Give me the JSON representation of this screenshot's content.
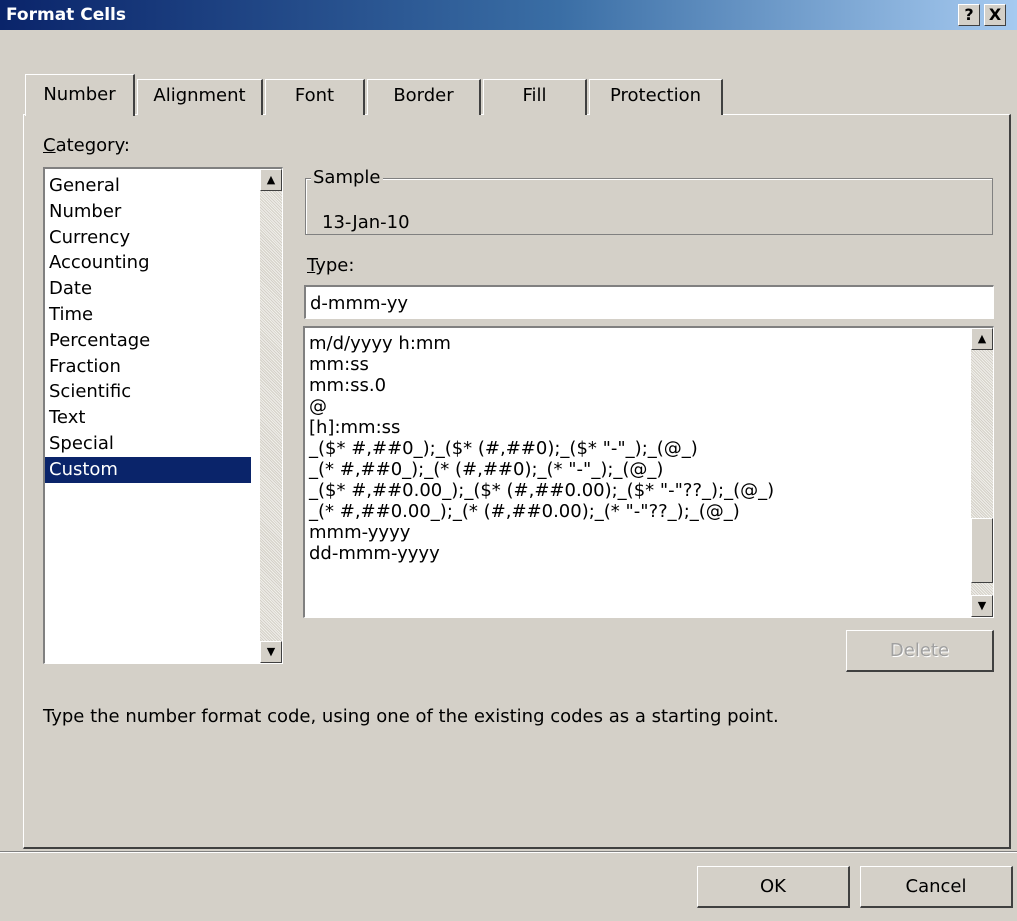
{
  "window": {
    "title": "Format Cells",
    "help_label": "?",
    "close_label": "X"
  },
  "tabs": [
    {
      "label": "Number",
      "active": true
    },
    {
      "label": "Alignment"
    },
    {
      "label": "Font"
    },
    {
      "label": "Border"
    },
    {
      "label": "Fill"
    },
    {
      "label": "Protection"
    }
  ],
  "category": {
    "label_prefix": "C",
    "label_rest": "ategory:",
    "items": [
      "General",
      "Number",
      "Currency",
      "Accounting",
      "Date",
      "Time",
      "Percentage",
      "Fraction",
      "Scientific",
      "Text",
      "Special",
      "Custom"
    ],
    "selected": "Custom"
  },
  "sample": {
    "legend": "Sample",
    "value": "13-Jan-10"
  },
  "type": {
    "label_prefix": "T",
    "label_rest": "ype:",
    "value": "d-mmm-yy",
    "formats": [
      "m/d/yyyy h:mm",
      "mm:ss",
      "mm:ss.0",
      "@",
      "[h]:mm:ss",
      "_($* #,##0_);_($* (#,##0);_($* \"-\"_);_(@_)",
      "_(* #,##0_);_(* (#,##0);_(* \"-\"_);_(@_)",
      "_($* #,##0.00_);_($* (#,##0.00);_($* \"-\"??_);_(@_)",
      "_(* #,##0.00_);_(* (#,##0.00);_(* \"-\"??_);_(@_)",
      "mmm-yyyy",
      "dd-mmm-yyyy"
    ]
  },
  "buttons": {
    "delete": "Delete",
    "ok": "OK",
    "cancel": "Cancel"
  },
  "hint": "Type the number format code, using one of the existing codes as a starting point.",
  "icons": {
    "scroll_up": "▲",
    "scroll_down": "▼"
  }
}
